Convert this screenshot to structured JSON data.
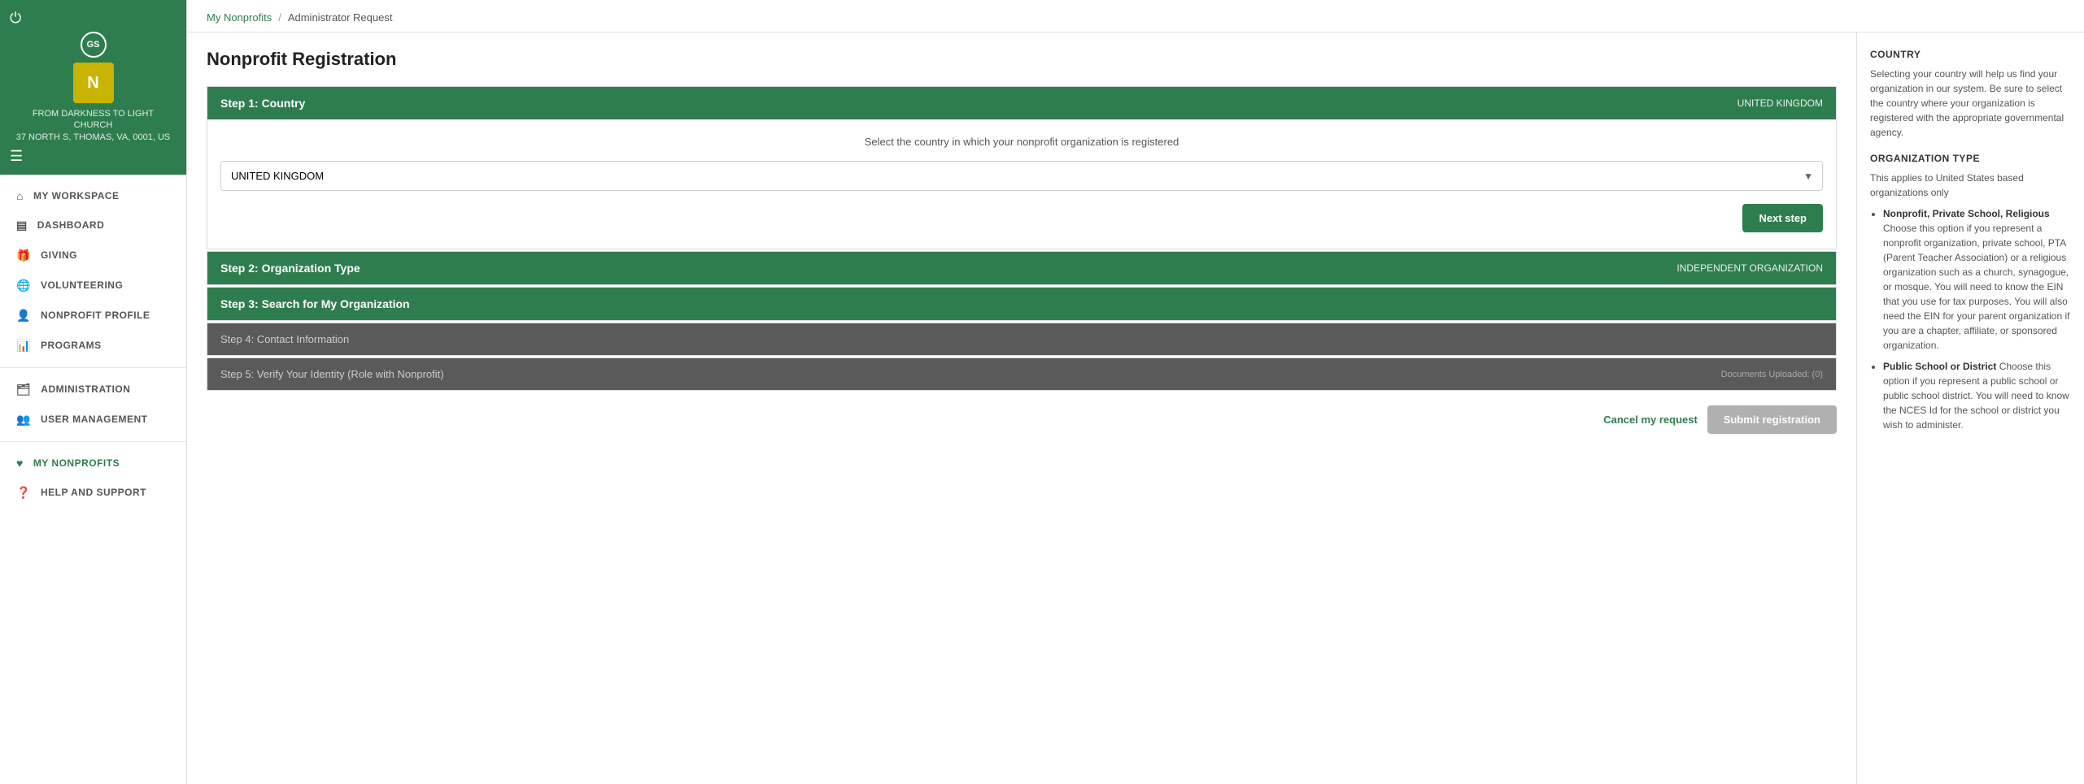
{
  "sidebar": {
    "power_icon": "⏻",
    "user_initials": "GS",
    "org_name_line1": "FROM DARKNESS TO LIGHT",
    "org_name_line2": "CHURCH",
    "org_address": "37 NORTH S, THOMAS, VA, 0001, US",
    "hamburger_icon": "☰",
    "nav_items": [
      {
        "id": "my-workspace",
        "label": "MY WORKSPACE",
        "icon": "⌂"
      },
      {
        "id": "dashboard",
        "label": "DASHBOARD",
        "icon": "▤"
      },
      {
        "id": "giving",
        "label": "GIVING",
        "icon": "🎁"
      },
      {
        "id": "volunteering",
        "label": "VOLUNTEERING",
        "icon": "🌐"
      },
      {
        "id": "nonprofit-profile",
        "label": "NONPROFIT PROFILE",
        "icon": "👤"
      },
      {
        "id": "programs",
        "label": "PROGRAMS",
        "icon": "📊"
      },
      {
        "id": "administration",
        "label": "ADMINISTRATION",
        "icon": "🗂"
      },
      {
        "id": "user-management",
        "label": "USER MANAGEMENT",
        "icon": "👥"
      },
      {
        "id": "my-nonprofits",
        "label": "MY NONPROFITS",
        "icon": "♥",
        "active": true
      },
      {
        "id": "help-and-support",
        "label": "HELP AND SUPPORT",
        "icon": "❓"
      }
    ]
  },
  "breadcrumb": {
    "link_label": "My Nonprofits",
    "separator": "/",
    "current": "Administrator Request"
  },
  "page": {
    "title": "Nonprofit Registration"
  },
  "steps": {
    "step1": {
      "header": "Step 1: Country",
      "country_value": "UNITED KINGDOM",
      "description": "Select the country in which your nonprofit organization is registered",
      "select_value": "UNITED KINGDOM",
      "next_button": "Next step"
    },
    "step2": {
      "header": "Step 2: Organization Type",
      "value": "Independent organization"
    },
    "step3": {
      "header": "Step 3: Search for My Organization"
    },
    "step4": {
      "header": "Step 4: Contact Information"
    },
    "step5": {
      "header": "Step 5: Verify Your Identity (Role with Nonprofit)",
      "value": "Documents Uploaded: (0)"
    }
  },
  "actions": {
    "cancel_label": "Cancel my request",
    "submit_label": "Submit registration"
  },
  "right_panel": {
    "country_title": "COUNTRY",
    "country_text": "Selecting your country will help us find your organization in our system. Be sure to select the country where your organization is registered with the appropriate governmental agency.",
    "org_type_title": "ORGANIZATION TYPE",
    "org_type_note": "This applies to United States based organizations only",
    "org_type_items": [
      {
        "bold": "Nonprofit, Private School, Religious",
        "text": "Choose this option if you represent a nonprofit organization, private school, PTA (Parent Teacher Association) or a religious organization such as a church, synagogue, or mosque. You will need to know the EIN that you use for tax purposes. You will also need the EIN for your parent organization if you are a chapter, affiliate, or sponsored organization."
      },
      {
        "bold": "Public School or District",
        "text": "Choose this option if you represent a public school or public school district. You will need to know the NCES Id for the school or district you wish to administer."
      }
    ]
  }
}
